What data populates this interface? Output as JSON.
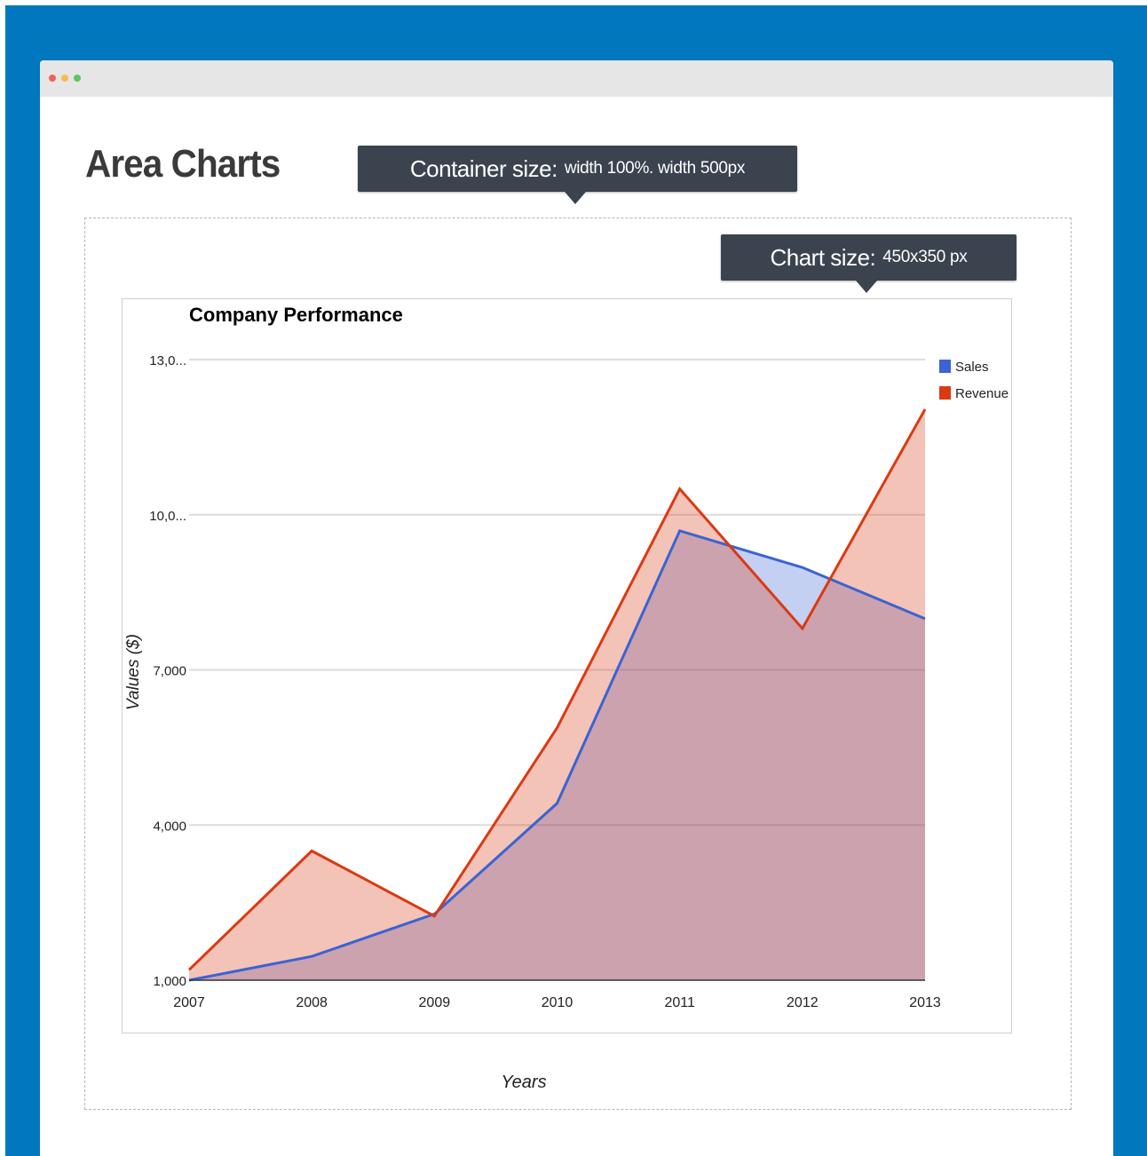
{
  "page": {
    "heading": "Area Charts",
    "container_callout": {
      "label": "Container size:",
      "detail": "width 100%. width 500px"
    },
    "chart_callout": {
      "label": "Chart size:",
      "detail": "450x350 px"
    }
  },
  "colors": {
    "frame": "#0177bd",
    "titlebar": "#e6e6e6",
    "dot_red": "#f0605a",
    "dot_yellow": "#f4bd4f",
    "dot_green": "#5ac85a",
    "callout_bg": "#3a434e",
    "sales": "#3b63d3",
    "revenue": "#dc3912"
  },
  "chart_data": {
    "type": "area",
    "title": "Company Performance",
    "xlabel": "Years",
    "ylabel": "Values ($)",
    "categories": [
      "2007",
      "2008",
      "2009",
      "2010",
      "2011",
      "2012",
      "2013"
    ],
    "ylim": [
      1000,
      13000
    ],
    "yticks": [
      1000,
      4000,
      7000,
      10000,
      13000
    ],
    "ytick_labels": [
      "1,000",
      "4,000",
      "7,000",
      "10,0...",
      "13,0..."
    ],
    "grid": true,
    "legend_position": "top-right",
    "series": [
      {
        "name": "Sales",
        "color": "#3b63d3",
        "values": [
          1000,
          1460,
          2280,
          4420,
          9690,
          8980,
          7990
        ]
      },
      {
        "name": "Revenue",
        "color": "#dc3912",
        "values": [
          1200,
          3500,
          2240,
          5880,
          10500,
          7800,
          12040
        ]
      }
    ]
  }
}
